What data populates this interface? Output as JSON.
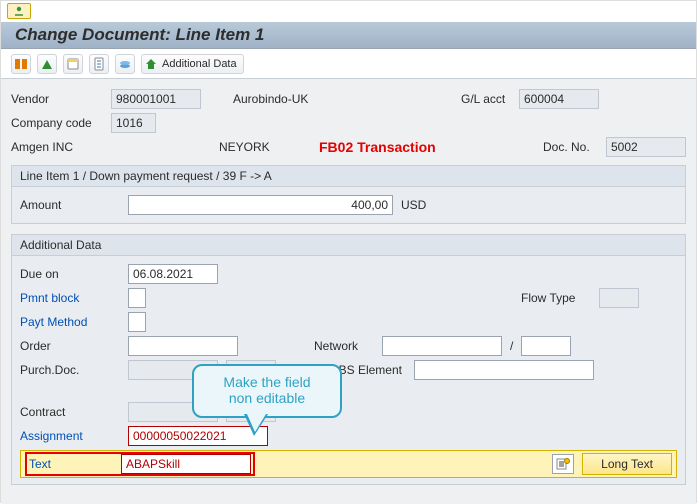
{
  "window": {
    "title": "Change Document: Line Item 1",
    "toolbar": {
      "additional_data_label": "Additional Data",
      "icons": [
        "choose-icon",
        "overview-icon",
        "header-icon",
        "create-icon",
        "services-icon",
        "additional-data-icon"
      ]
    }
  },
  "header": {
    "vendor_label": "Vendor",
    "vendor_value": "980001001",
    "vendor_name": "Aurobindo-UK",
    "gl_label": "G/L acct",
    "gl_value": "600004",
    "company_code_label": "Company code",
    "company_code_value": "1016",
    "company_name": "Amgen INC",
    "city": "NEYORK",
    "docno_label": "Doc. No.",
    "docno_value": "5002"
  },
  "annotation": {
    "transaction": "FB02 Transaction",
    "callout_line1": "Make the field",
    "callout_line2": "non editable"
  },
  "item_panel": {
    "title": "Line Item 1 / Down payment request / 39 F -> A",
    "amount_label": "Amount",
    "amount_value": "400,00",
    "amount_currency": "USD"
  },
  "additional": {
    "title": "Additional Data",
    "due_on_label": "Due on",
    "due_on_value": "06.08.2021",
    "pmnt_block_label": "Pmnt block",
    "pmnt_block_value": "",
    "flow_type_label": "Flow Type",
    "flow_type_value": "",
    "payt_method_label": "Payt Method",
    "payt_method_value": "",
    "order_label": "Order",
    "order_value": "",
    "network_label": "Network",
    "network_value": "",
    "network_op_value": "",
    "purch_doc_label": "Purch.Doc.",
    "purch_doc_value": "",
    "purch_item_value": "",
    "wbs_label": "BS Element",
    "wbs_value": "",
    "contract_label": "Contract",
    "contract_value": "",
    "contract_item_value": "",
    "assignment_label": "Assignment",
    "assignment_value": "00000050022021",
    "text_label": "Text",
    "text_value": "ABAPSkill",
    "long_text_label": "Long Text"
  }
}
